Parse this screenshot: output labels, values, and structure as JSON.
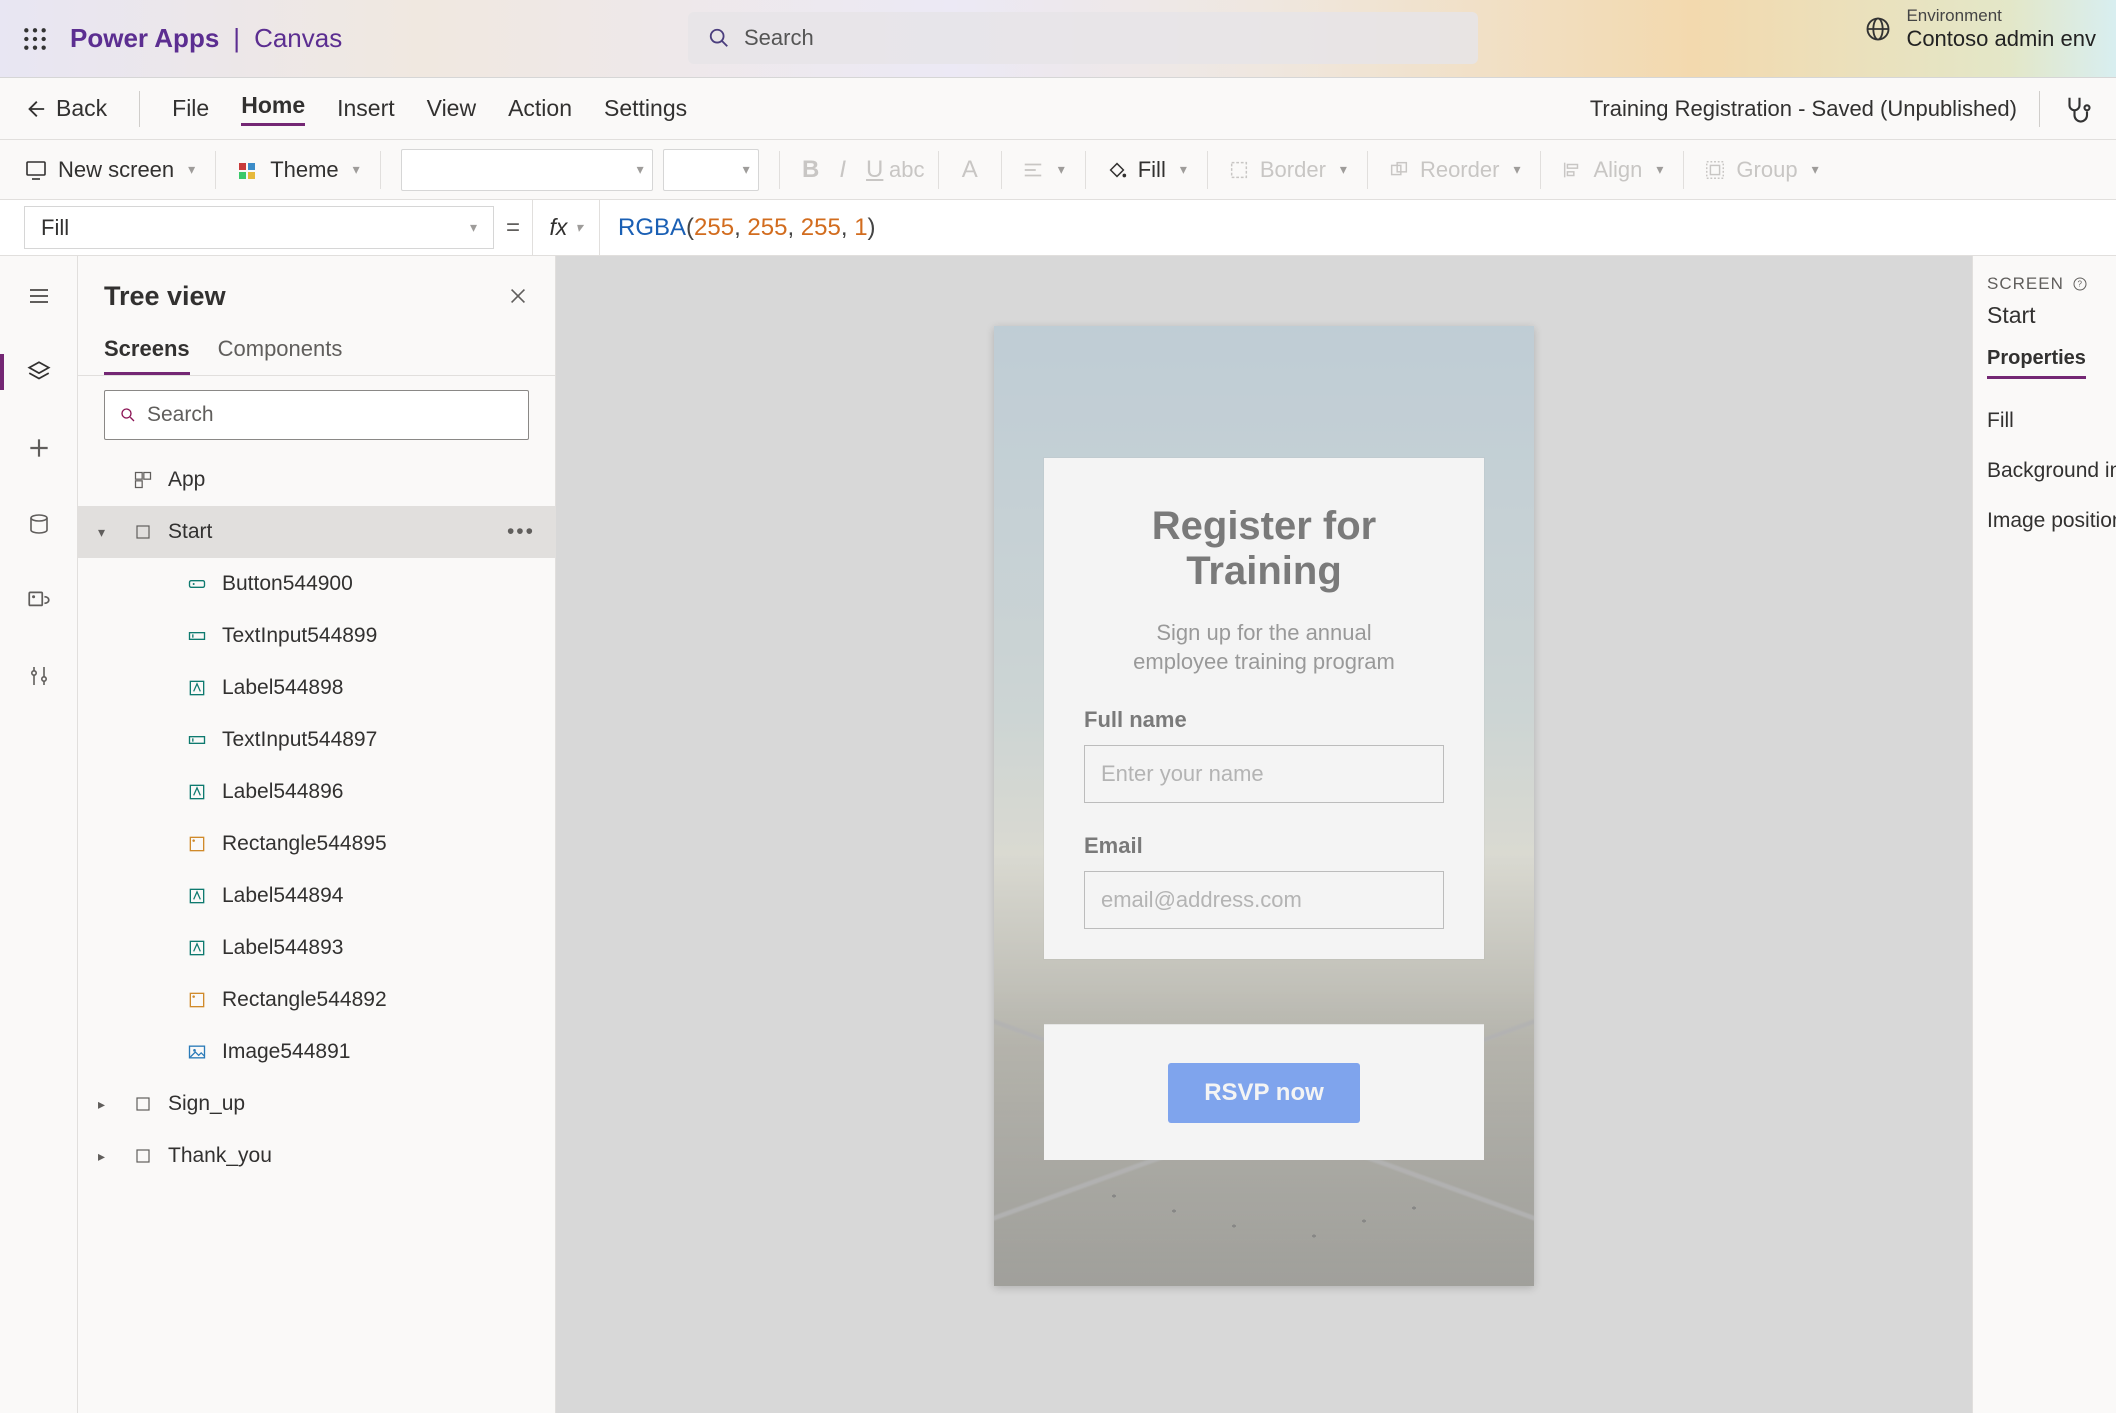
{
  "header": {
    "app_name": "Power Apps",
    "app_separator": "|",
    "app_sub": "Canvas",
    "search_placeholder": "Search",
    "env_label": "Environment",
    "env_value": "Contoso admin env"
  },
  "menubar": {
    "back": "Back",
    "items": [
      "File",
      "Home",
      "Insert",
      "View",
      "Action",
      "Settings"
    ],
    "active": "Home",
    "doc_status": "Training Registration - Saved (Unpublished)"
  },
  "toolbar": {
    "new_screen": "New screen",
    "theme": "Theme",
    "fill": "Fill",
    "border": "Border",
    "reorder": "Reorder",
    "align": "Align",
    "group": "Group"
  },
  "formula_bar": {
    "property": "Fill",
    "fx": "fx",
    "func": "RGBA",
    "args": [
      "255",
      "255",
      "255",
      "1"
    ]
  },
  "tree": {
    "title": "Tree view",
    "tabs": [
      "Screens",
      "Components"
    ],
    "active_tab": "Screens",
    "search_placeholder": "Search",
    "app_label": "App",
    "screens": [
      {
        "name": "Start",
        "expanded": true,
        "selected": true,
        "children": [
          {
            "name": "Button544900",
            "icon": "button"
          },
          {
            "name": "TextInput544899",
            "icon": "textinput"
          },
          {
            "name": "Label544898",
            "icon": "label"
          },
          {
            "name": "TextInput544897",
            "icon": "textinput"
          },
          {
            "name": "Label544896",
            "icon": "label"
          },
          {
            "name": "Rectangle544895",
            "icon": "rectangle"
          },
          {
            "name": "Label544894",
            "icon": "label"
          },
          {
            "name": "Label544893",
            "icon": "label"
          },
          {
            "name": "Rectangle544892",
            "icon": "rectangle"
          },
          {
            "name": "Image544891",
            "icon": "image"
          }
        ]
      },
      {
        "name": "Sign_up",
        "expanded": false
      },
      {
        "name": "Thank_you",
        "expanded": false
      }
    ]
  },
  "canvas": {
    "title_line1": "Register for",
    "title_line2": "Training",
    "subtitle_line1": "Sign up for the annual",
    "subtitle_line2": "employee training program",
    "fullname_label": "Full name",
    "fullname_placeholder": "Enter your name",
    "email_label": "Email",
    "email_placeholder": "email@address.com",
    "rsvp_label": "RSVP now"
  },
  "right_panel": {
    "caps": "Screen",
    "screen_name": "Start",
    "tab": "Properties",
    "rows": [
      "Fill",
      "Background image",
      "Image position"
    ]
  }
}
